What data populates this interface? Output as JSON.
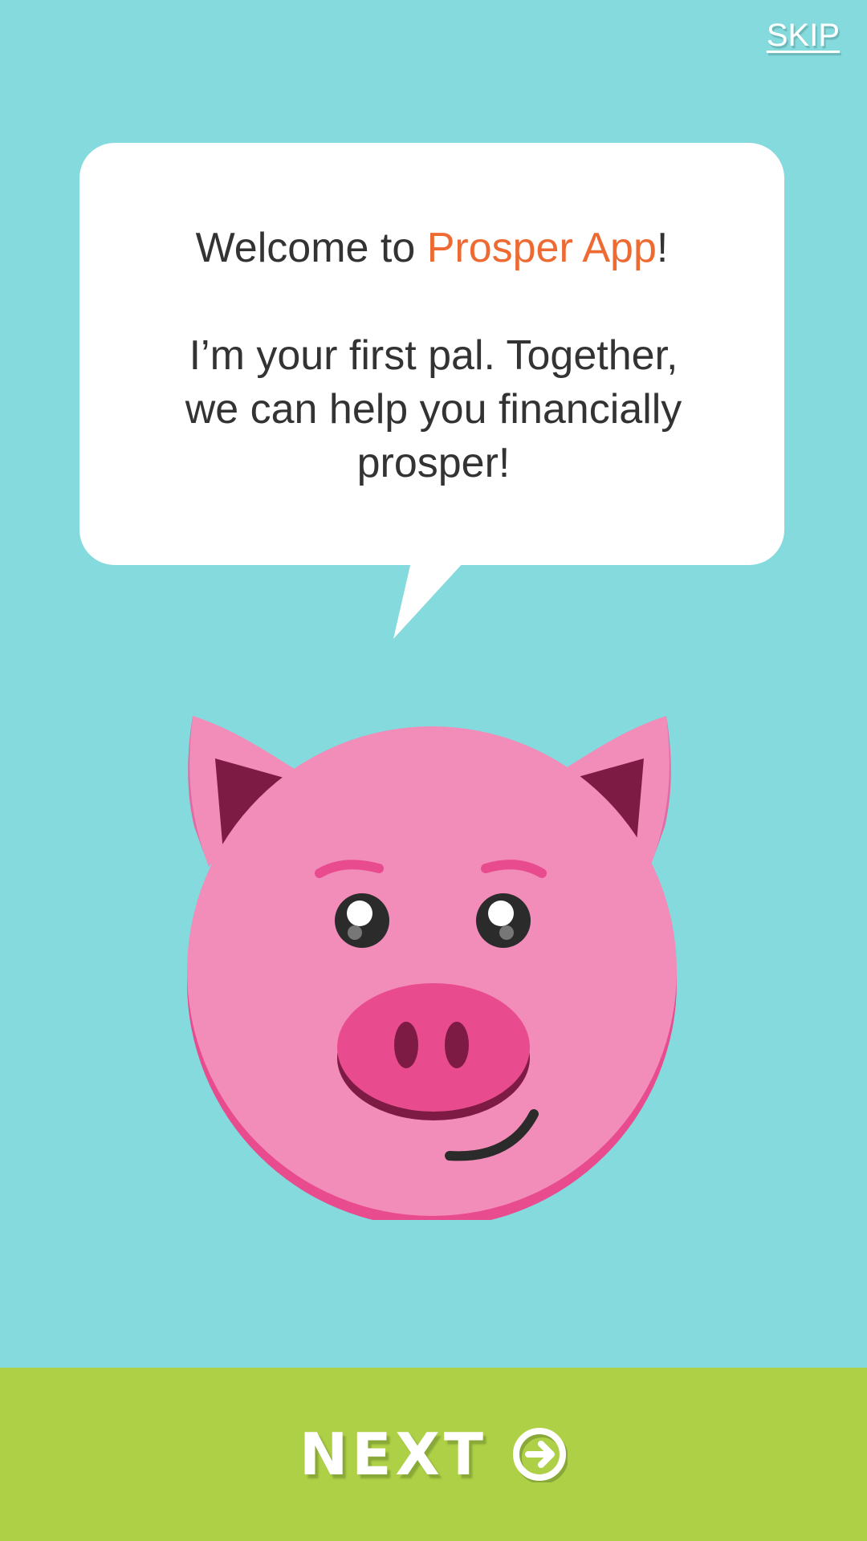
{
  "header": {
    "skip_label": "SKIP"
  },
  "bubble": {
    "welcome_prefix": "Welcome to ",
    "brand_name": "Prosper App",
    "welcome_suffix": "!",
    "body_line1": "I’m your first pal. Together,",
    "body_line2": "we can help you financially",
    "body_line3": "prosper!"
  },
  "mascot": {
    "icon": "pig-mascot-icon"
  },
  "footer": {
    "next_label": "NEXT",
    "next_icon": "arrow-right-circle-icon"
  },
  "colors": {
    "background": "#84DADD",
    "brand": "#EE6A33",
    "next_bar": "#AED046",
    "text": "#333333",
    "pig_face": "#F28CB8",
    "pig_snout": "#E94B8F",
    "pig_inner_ear": "#7E1B45"
  }
}
